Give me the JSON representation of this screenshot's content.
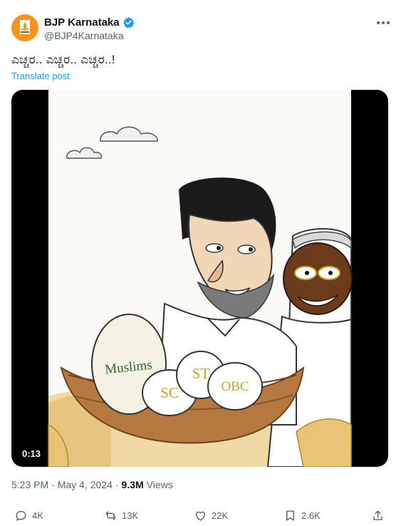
{
  "account": {
    "display_name": "BJP Karnataka",
    "handle": "@BJP4Karnataka",
    "avatar_icon": "lotus-logo-icon",
    "verified_icon": "verified-badge-icon",
    "more_icon": "more-icon"
  },
  "tweet": {
    "text": "ಎಚ್ಚರ.. ಎಚ್ಚರ.. ಎಚ್ಚರ..!",
    "translate_label": "Translate post"
  },
  "media": {
    "duration": "0:13",
    "egg_labels": [
      "Muslims",
      "SC",
      "ST",
      "OBC"
    ]
  },
  "meta": {
    "time": "5:23 PM",
    "separator": "·",
    "date": "May 4, 2024",
    "views_count": "9.3M",
    "views_label": "Views"
  },
  "actions": {
    "reply": {
      "icon": "reply-icon",
      "count": "4K"
    },
    "repost": {
      "icon": "repost-icon",
      "count": "13K"
    },
    "like": {
      "icon": "heart-icon",
      "count": "22K"
    },
    "bookmark": {
      "icon": "bookmark-icon",
      "count": "2.6K"
    },
    "share": {
      "icon": "share-icon"
    }
  },
  "colors": {
    "accent": "#1d9bf0",
    "avatar_bg": "#f7931e",
    "text_secondary": "#536471"
  }
}
